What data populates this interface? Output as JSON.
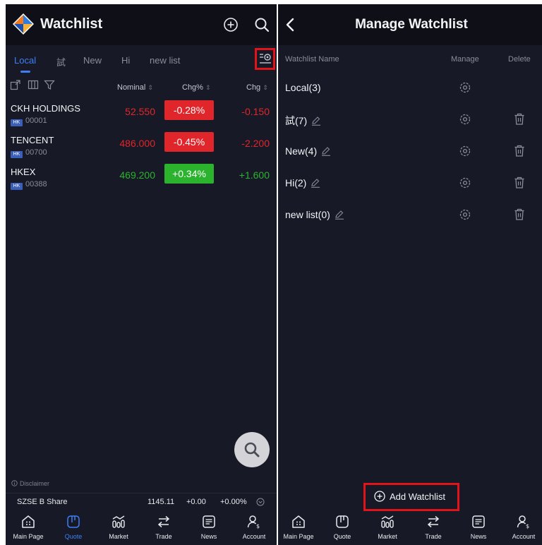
{
  "left": {
    "app_title": "Watchlist",
    "tabs": [
      {
        "label": "Local",
        "active": true
      },
      {
        "label": "試",
        "active": false
      },
      {
        "label": "New",
        "active": false
      },
      {
        "label": "Hi",
        "active": false
      },
      {
        "label": "new list",
        "active": false
      }
    ],
    "columns": {
      "nominal": "Nominal",
      "chg_pct": "Chg%",
      "chg": "Chg",
      "sort_glyph": "⇕"
    },
    "stocks": [
      {
        "name": "CKH HOLDINGS",
        "market": "HK",
        "code": "00001",
        "nominal": "52.550",
        "chg_pct": "-0.28%",
        "chg": "-0.150",
        "direction": "down"
      },
      {
        "name": "TENCENT",
        "market": "HK",
        "code": "00700",
        "nominal": "486.000",
        "chg_pct": "-0.45%",
        "chg": "-2.200",
        "direction": "down"
      },
      {
        "name": "HKEX",
        "market": "HK",
        "code": "00388",
        "nominal": "469.200",
        "chg_pct": "+0.34%",
        "chg": "+1.600",
        "direction": "up"
      }
    ],
    "disclaimer": "Disclaimer",
    "ticker": {
      "name": "SZSE B Share",
      "value": "1145.11",
      "change": "+0.00",
      "change_pct": "+0.00%"
    }
  },
  "right": {
    "title": "Manage Watchlist",
    "col_name": "Watchlist Name",
    "col_manage": "Manage",
    "col_delete": "Delete",
    "watchlists": [
      {
        "label": "Local(3)",
        "editable": false,
        "deletable": false
      },
      {
        "label": "試(7)",
        "editable": true,
        "deletable": true
      },
      {
        "label": "New(4)",
        "editable": true,
        "deletable": true
      },
      {
        "label": "Hi(2)",
        "editable": true,
        "deletable": true
      },
      {
        "label": "new list(0)",
        "editable": true,
        "deletable": true
      }
    ],
    "add_label": "Add Watchlist"
  },
  "nav": [
    {
      "label": "Main Page",
      "icon": "home-icon"
    },
    {
      "label": "Quote",
      "icon": "quote-icon"
    },
    {
      "label": "Market",
      "icon": "market-icon"
    },
    {
      "label": "Trade",
      "icon": "trade-icon"
    },
    {
      "label": "News",
      "icon": "news-icon"
    },
    {
      "label": "Account",
      "icon": "account-icon"
    }
  ],
  "colors": {
    "accent": "#3d7ff5",
    "down": "#e0252b",
    "up": "#2bb32e",
    "highlight": "#e2141a"
  }
}
